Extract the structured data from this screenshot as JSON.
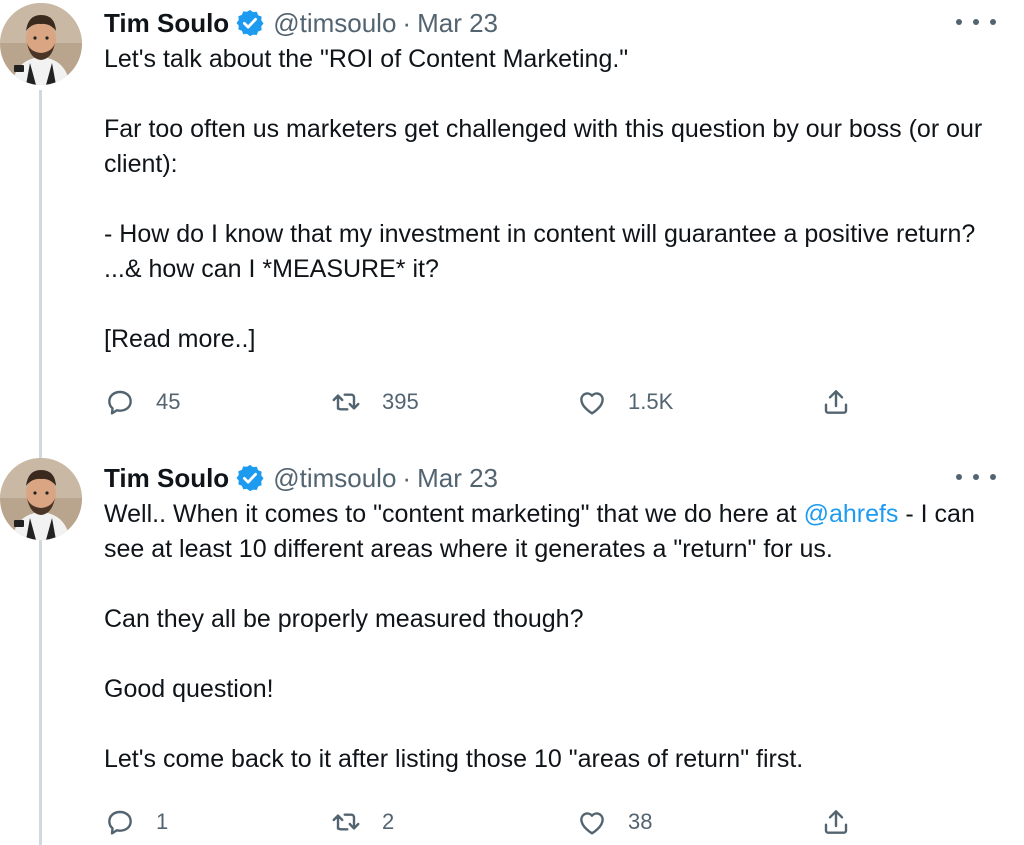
{
  "tweets": [
    {
      "author": "Tim Soulo",
      "handle": "@timsoulo",
      "separator": "·",
      "date": "Mar 23",
      "paragraphs": [
        "Let's talk about the \"ROI of Content Marketing.\"",
        "Far too often us marketers get challenged with this question by our boss (or our client):",
        "- How do I know that my investment in content will guarantee a positive return? ...& how can I *MEASURE* it?",
        "[Read more..]"
      ],
      "stats": {
        "replies": "45",
        "retweets": "395",
        "likes": "1.5K"
      }
    },
    {
      "author": "Tim Soulo",
      "handle": "@timsoulo",
      "separator": "·",
      "date": "Mar 23",
      "p1_before": "Well.. When it comes to \"content marketing\" that we do here at ",
      "p1_mention": "@ahrefs",
      "p1_after": " - I can see at least 10 different areas where it generates a \"return\" for us.",
      "paragraphs": [
        "Can they all be properly measured though?",
        "Good question!",
        "Let's come back to it after listing those 10 \"areas of return\" first."
      ],
      "stats": {
        "replies": "1",
        "retweets": "2",
        "likes": "38"
      }
    }
  ],
  "icons": {
    "verified": "verified-badge-icon",
    "reply": "reply-icon",
    "retweet": "retweet-icon",
    "like": "heart-icon",
    "share": "share-icon",
    "more": "more-options-icon"
  },
  "colors": {
    "text": "#0f1419",
    "secondary": "#536471",
    "link": "#1d9bf0",
    "thread_line": "#cfd9de",
    "verified": "#1d9bf0"
  }
}
